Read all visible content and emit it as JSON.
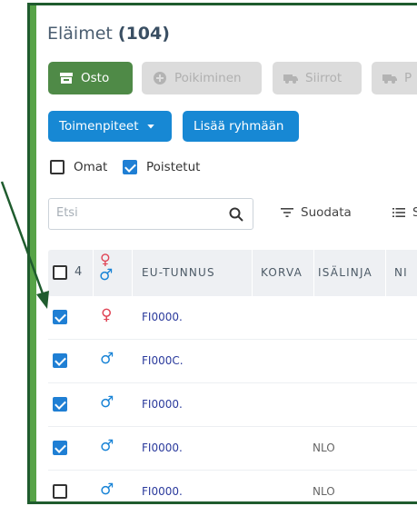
{
  "header": {
    "title": "Eläimet",
    "count": "(104)"
  },
  "actions": {
    "osto": "Osto",
    "poikiminen": "Poikiminen",
    "siirrot": "Siirrot",
    "p": "P"
  },
  "secondary": {
    "toimenpiteet": "Toimenpiteet",
    "lisaa_ryhmaan": "Lisää ryhmään"
  },
  "filters": {
    "omat": {
      "label": "Omat",
      "checked": false
    },
    "poistetut": {
      "label": "Poistetut",
      "checked": true
    }
  },
  "search": {
    "placeholder": "Etsi",
    "value": ""
  },
  "toolbar": {
    "suodata": "Suodata",
    "s": "S"
  },
  "table": {
    "selected_count": "4",
    "columns": [
      "EU-TUNNUS",
      "KORVA",
      "ISÄLINJA",
      "NI"
    ],
    "rows": [
      {
        "checked": true,
        "sex": "♀",
        "eu": "FI0000.",
        "korva": ""
      },
      {
        "checked": true,
        "sex": "♂",
        "eu": "FI000C.",
        "korva": ""
      },
      {
        "checked": true,
        "sex": "♂",
        "eu": "FI0000.",
        "korva": ""
      },
      {
        "checked": true,
        "sex": "♂",
        "eu": "FI0000.",
        "korva": "NLO"
      },
      {
        "checked": false,
        "sex": "♂",
        "eu": "FI0000.",
        "korva": "NLO"
      }
    ]
  },
  "colors": {
    "frame_border": "#1f5c2e",
    "accent_green": "#57a347",
    "button_green": "#4f8a47",
    "button_blue": "#1788d4",
    "female": "#e04455",
    "male": "#1883d6",
    "link": "#2a3a9c"
  }
}
